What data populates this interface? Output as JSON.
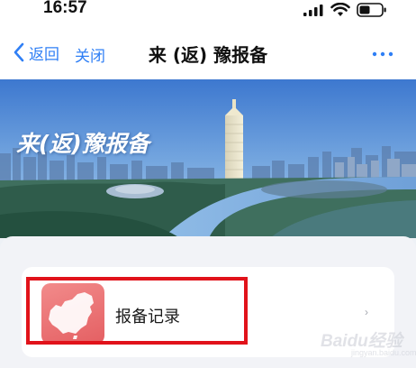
{
  "status_bar": {
    "time": "16:57"
  },
  "nav": {
    "back_label": "返回",
    "close_label": "关闭",
    "title": "来 (返) 豫报备",
    "more_icon": "more-dots-icon"
  },
  "banner": {
    "title": "来(返)豫报备"
  },
  "record_card": {
    "label": "报备记录",
    "icon": "china-map-icon",
    "chevron": "›"
  },
  "watermark": {
    "text": "Baidu经验",
    "sub": "jingyan.baidu.com"
  },
  "colors": {
    "accent": "#2f7ff5",
    "highlight": "#e1121a",
    "icon_bg": "#e8686b"
  }
}
